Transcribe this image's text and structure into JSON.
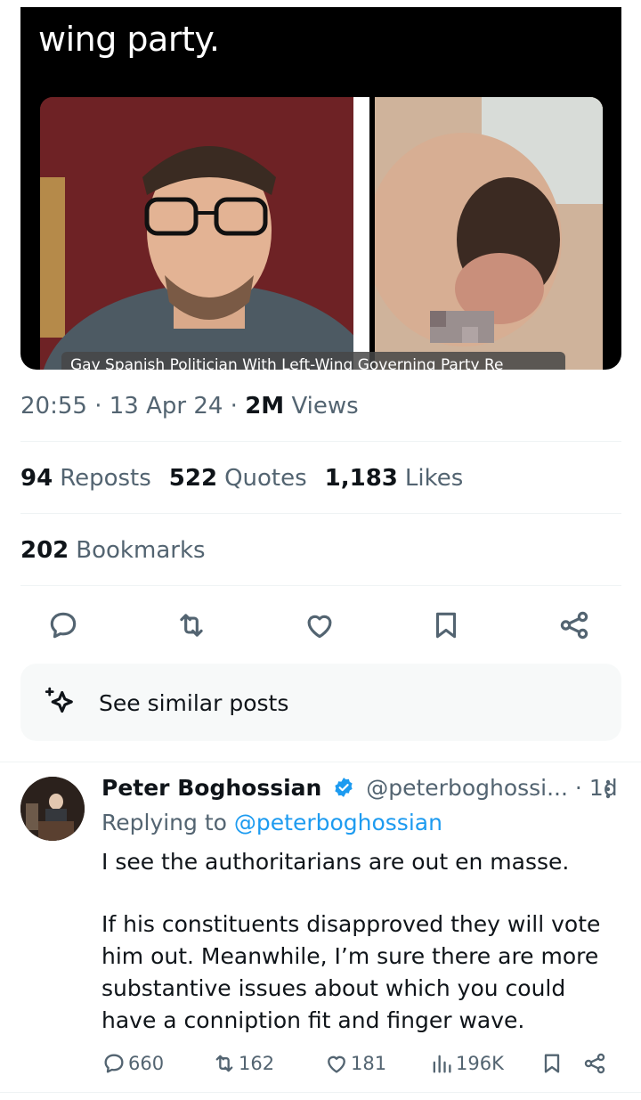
{
  "media": {
    "text": "wing party.",
    "caption": "Gay Spanish Politician With Left-Wing Governing Party Re"
  },
  "tweet_meta": {
    "time": "20:55",
    "sep1": " · ",
    "date": "13 Apr 24",
    "sep2": " · ",
    "views_count": "2M",
    "views_label": " Views"
  },
  "stats": {
    "reposts_count": "94",
    "reposts_label": "Reposts",
    "quotes_count": "522",
    "quotes_label": "Quotes",
    "likes_count": "1,183",
    "likes_label": "Likes",
    "bookmarks_count": "202",
    "bookmarks_label": "Bookmarks"
  },
  "actions": [
    "reply-icon",
    "repost-icon",
    "like-icon",
    "bookmark-icon",
    "share-icon"
  ],
  "similar": {
    "label": "See similar posts",
    "icon": "sparkle-icon"
  },
  "reply": {
    "name": "Peter Boghossian",
    "handle": "@peterboghossi...",
    "dot": " · ",
    "age": "1d",
    "replying_prefix": "Replying to ",
    "replying_handle": "@peterboghossian",
    "paragraph1": "I see the authoritarians are out en masse.",
    "paragraph2": "If his constituents disapproved they will vote him out. Meanwhile, I’m sure there are more substantive issues about which you could have a conniption fit and finger wave.",
    "replies": "660",
    "reposts": "162",
    "likes": "181",
    "views": "196K"
  },
  "colors": {
    "link": "#1d9bf0",
    "secondary": "#536471",
    "primary": "#0f1419",
    "verified": "#1d9bf0"
  }
}
